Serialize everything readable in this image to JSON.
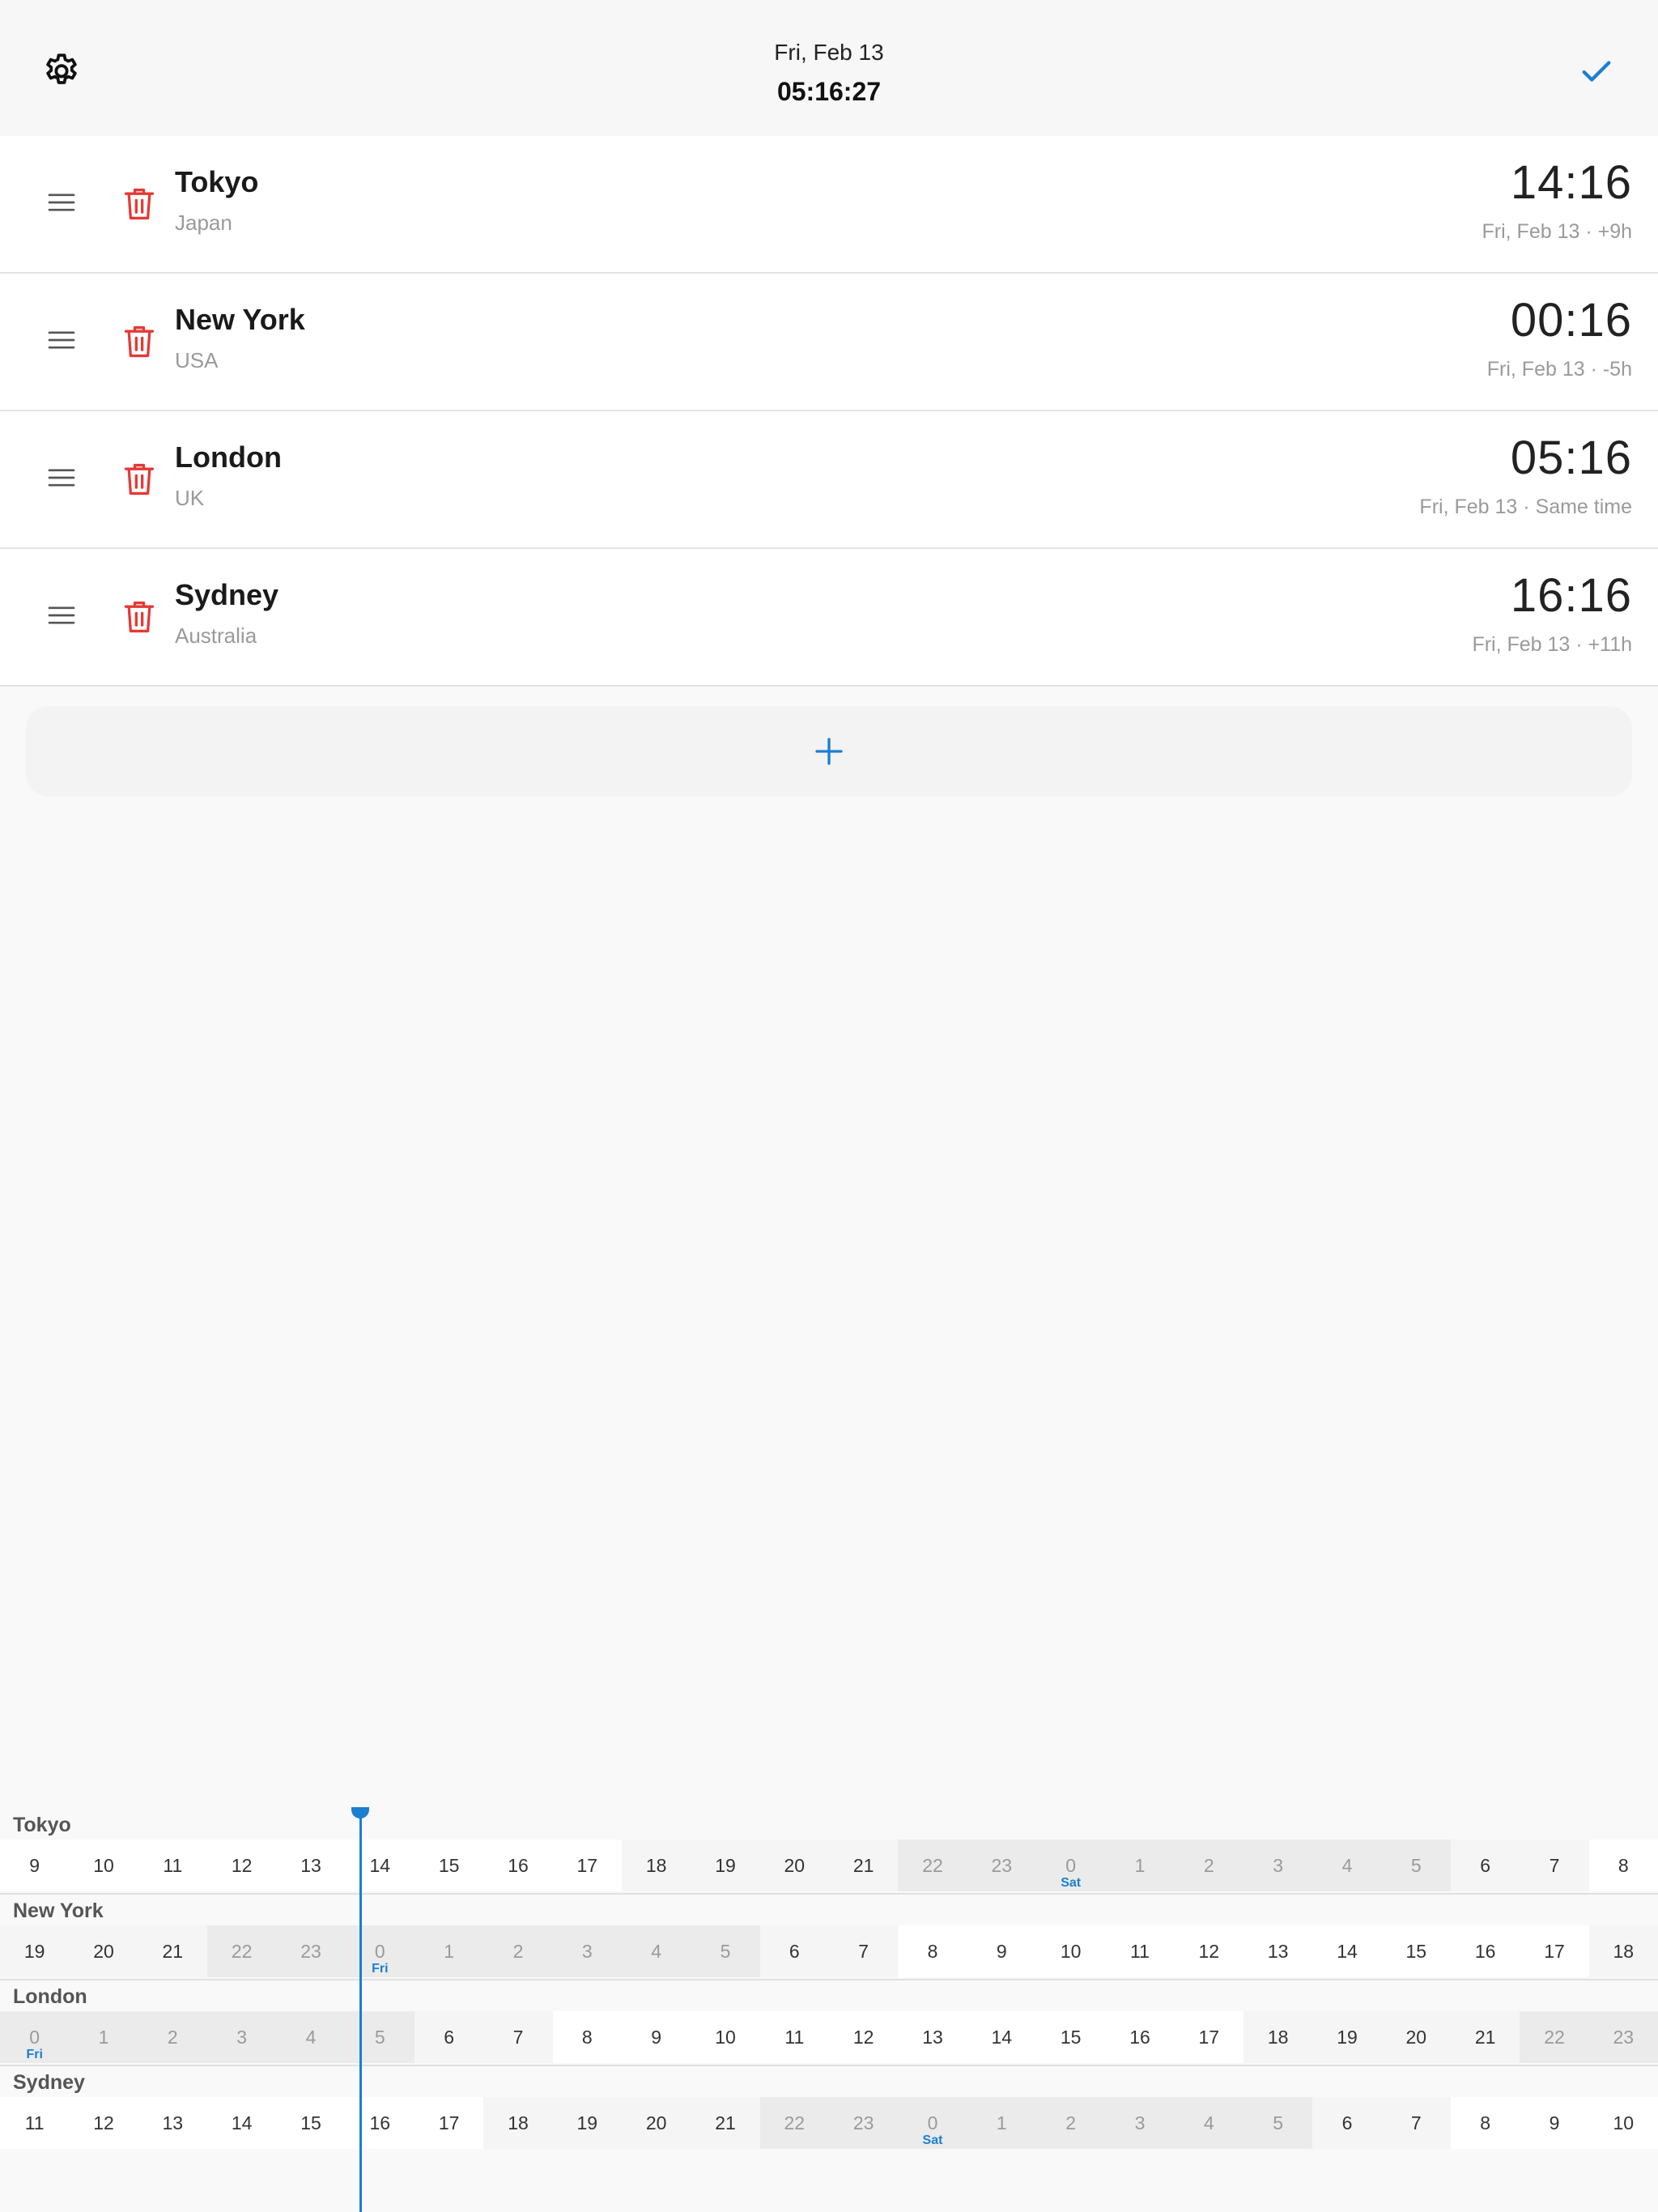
{
  "header": {
    "date": "Fri, Feb 13",
    "time": "05:16:27",
    "settings_icon": "gear-icon",
    "confirm_icon": "check-icon",
    "accent_color": "#1a7fd0"
  },
  "cities": [
    {
      "name": "Tokyo",
      "country": "Japan",
      "time": "14:16",
      "sub": "Fri, Feb 13 · +9h"
    },
    {
      "name": "New York",
      "country": "USA",
      "time": "00:16",
      "sub": "Fri, Feb 13 · -5h"
    },
    {
      "name": "London",
      "country": "UK",
      "time": "05:16",
      "sub": "Fri, Feb 13 · Same time"
    },
    {
      "name": "Sydney",
      "country": "Australia",
      "time": "16:16",
      "sub": "Fri, Feb 13 · +11h"
    }
  ],
  "add_button": {
    "label": "+"
  },
  "timeline": {
    "rows": [
      {
        "name": "Tokyo",
        "hours": [
          9,
          10,
          11,
          12,
          13,
          14,
          15,
          16,
          17,
          18,
          19,
          20,
          21,
          22,
          23,
          0,
          1,
          2,
          3,
          4,
          5,
          6,
          7,
          8
        ],
        "day_tag": "Sat",
        "day_tag_hour_index": 15
      },
      {
        "name": "New York",
        "hours": [
          19,
          20,
          21,
          22,
          23,
          0,
          1,
          2,
          3,
          4,
          5,
          6,
          7,
          8,
          9,
          10,
          11,
          12,
          13,
          14,
          15,
          16,
          17,
          18
        ],
        "day_tag": "Fri",
        "day_tag_hour_index": 5
      },
      {
        "name": "London",
        "hours": [
          0,
          1,
          2,
          3,
          4,
          5,
          6,
          7,
          8,
          9,
          10,
          11,
          12,
          13,
          14,
          15,
          16,
          17,
          18,
          19,
          20,
          21,
          22,
          23
        ],
        "day_tag": "Fri",
        "day_tag_hour_index": 0
      },
      {
        "name": "Sydney",
        "hours": [
          11,
          12,
          13,
          14,
          15,
          16,
          17,
          18,
          19,
          20,
          21,
          22,
          23,
          0,
          1,
          2,
          3,
          4,
          5,
          6,
          7,
          8,
          9,
          10
        ],
        "day_tag": "Sat",
        "day_tag_hour_index": 13
      }
    ]
  }
}
